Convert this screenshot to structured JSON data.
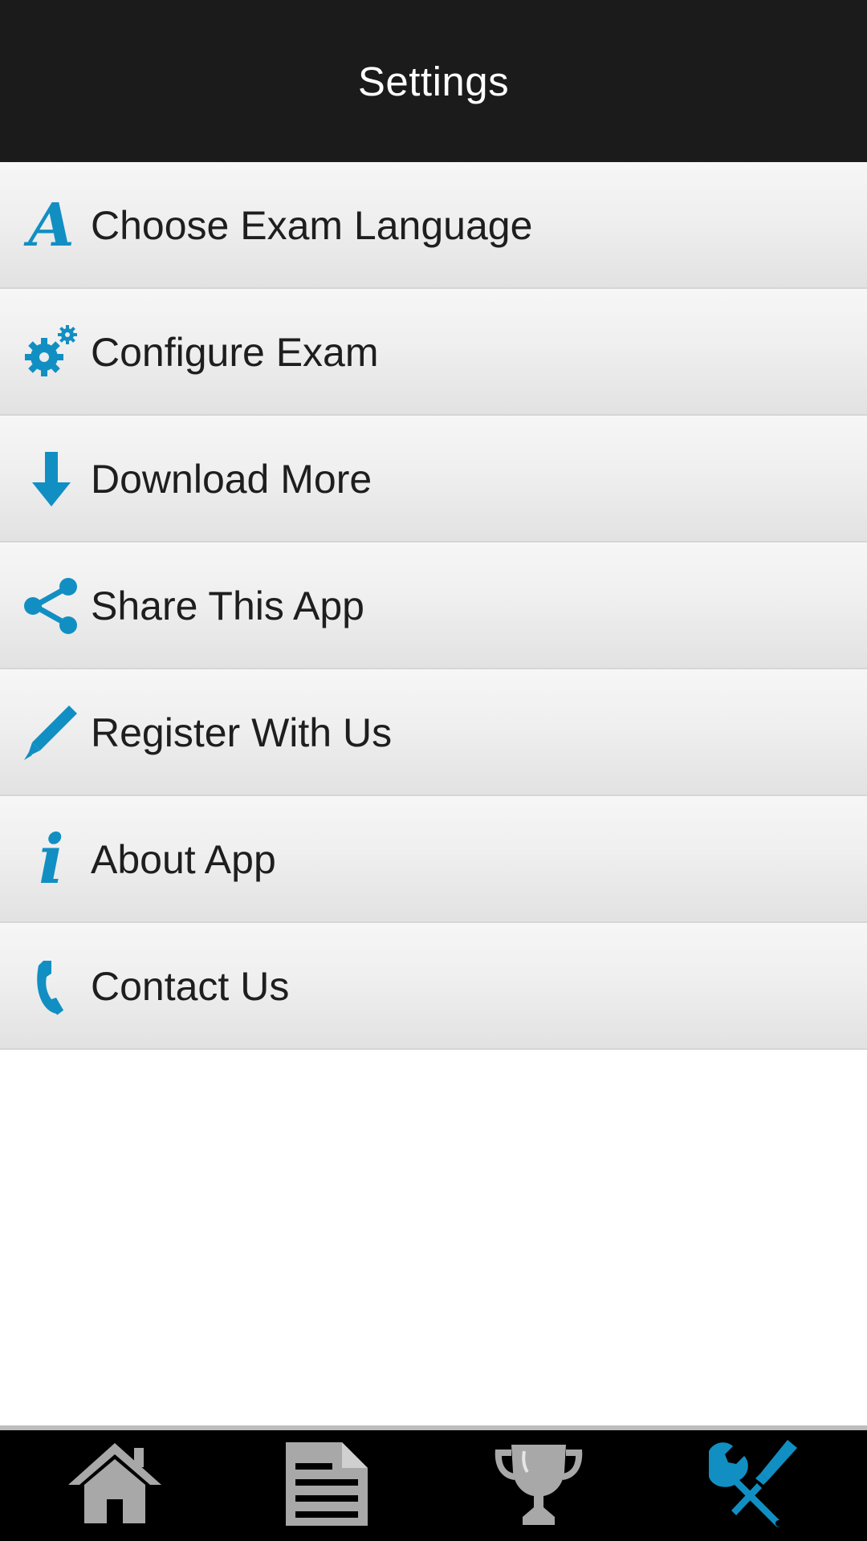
{
  "header": {
    "title": "Settings"
  },
  "menu": {
    "items": [
      {
        "id": "choose-exam-language",
        "label": "Choose Exam Language",
        "icon": "language-icon",
        "icon_glyph": "A"
      },
      {
        "id": "configure-exam",
        "label": "Configure Exam",
        "icon": "gears-icon"
      },
      {
        "id": "download-more",
        "label": "Download More",
        "icon": "download-arrow-icon"
      },
      {
        "id": "share-this-app",
        "label": "Share This App",
        "icon": "share-icon"
      },
      {
        "id": "register-with-us",
        "label": "Register With Us",
        "icon": "pencil-icon"
      },
      {
        "id": "about-app",
        "label": "About App",
        "icon": "info-icon",
        "icon_glyph": "i"
      },
      {
        "id": "contact-us",
        "label": "Contact Us",
        "icon": "phone-icon"
      }
    ]
  },
  "bottom_nav": {
    "tabs": [
      {
        "id": "home",
        "icon": "home-icon",
        "active": false
      },
      {
        "id": "exam",
        "icon": "document-icon",
        "active": false
      },
      {
        "id": "results",
        "icon": "trophy-icon",
        "active": false
      },
      {
        "id": "settings",
        "icon": "tools-icon",
        "active": true
      }
    ]
  },
  "colors": {
    "accent": "#118fc3",
    "header_bg": "#1b1b1b",
    "nav_bg": "#000000",
    "inactive_icon": "#a8a8a8"
  }
}
